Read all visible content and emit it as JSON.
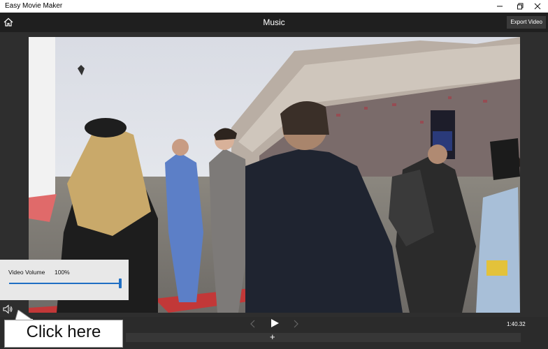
{
  "window": {
    "title": "Easy Movie Maker",
    "controls": [
      "minimize-icon",
      "maximize-icon",
      "close-icon"
    ]
  },
  "appbar": {
    "home_icon": "home-icon",
    "title": "Music",
    "export_label": "Export Video"
  },
  "video": {
    "description_icon": "video-frame"
  },
  "playback": {
    "prev_icon": "chevron-left-icon",
    "play_icon": "play-icon",
    "next_icon": "chevron-right-icon",
    "time": "1:40.32",
    "add_label": "+"
  },
  "volume": {
    "label": "Video Volume",
    "value": "100%",
    "level": 1.0,
    "speaker_icon": "speaker-icon"
  },
  "callout": {
    "text": "Click here"
  },
  "colors": {
    "accent": "#1f6fc4",
    "appbar": "#1f1f1f",
    "stage": "#2e2e2e"
  }
}
